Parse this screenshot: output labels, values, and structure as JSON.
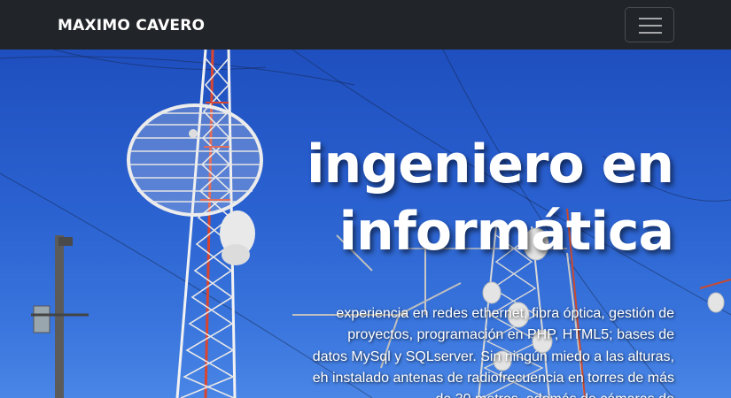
{
  "navbar": {
    "brand": "MAXIMO CAVERO",
    "toggle_icon": "hamburger-menu-icon"
  },
  "hero": {
    "title_line1": "ingeniero en",
    "title_line2": "informática",
    "description": "experiencia en redes ethernet, fibra óptica, gestión de proyectos, programación en PHP, HTML5; bases de datos MySql y SQLserver. Sin ningún miedo a las alturas, eh instalado antenas de radiofrecuencia en torres de más de 30 metros, además de cámaras de"
  },
  "colors": {
    "navbar_bg": "#212529",
    "sky": "#2a61d0",
    "text": "#ffffff",
    "tower_red": "#d9452f"
  }
}
